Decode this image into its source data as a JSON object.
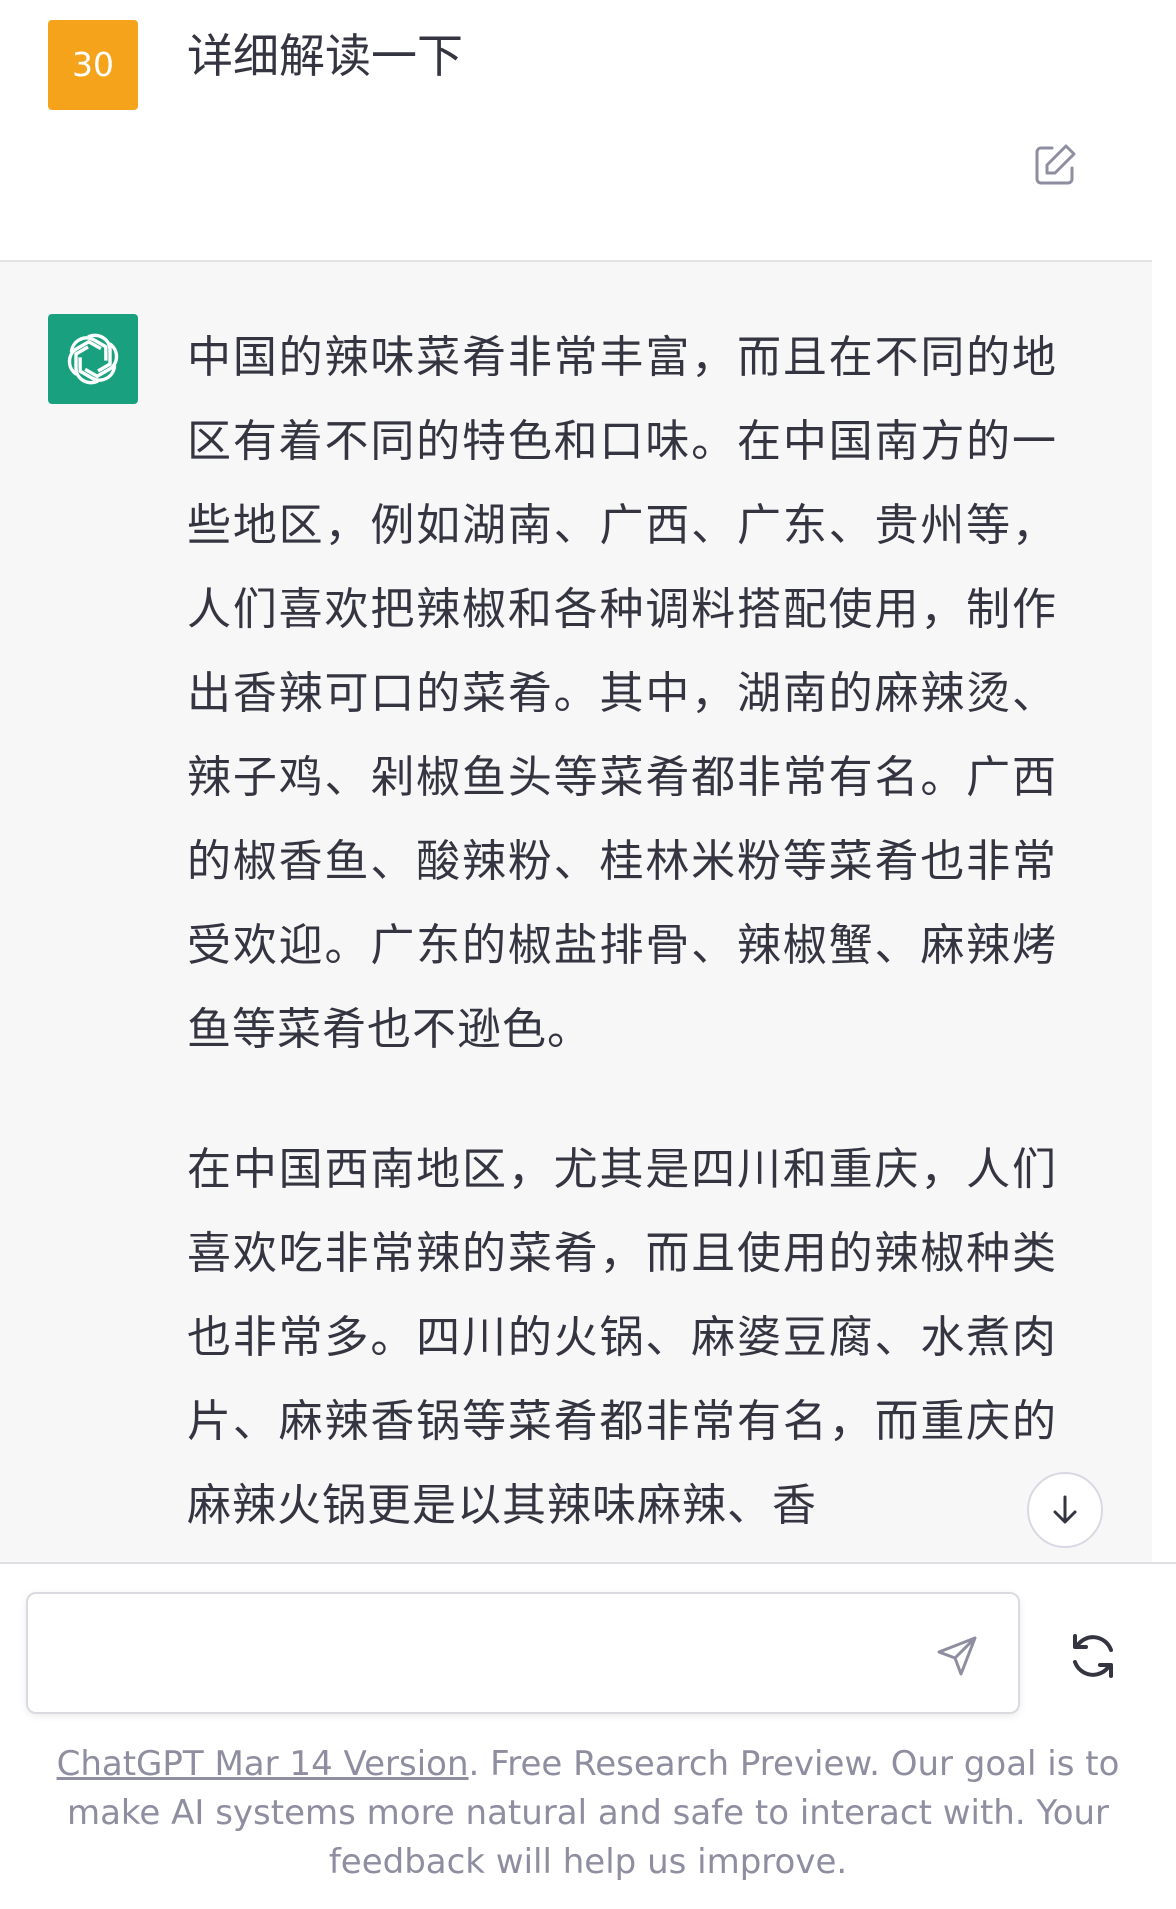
{
  "user_message": {
    "avatar_text": "30",
    "text": "详细解读一下",
    "edit_icon": "edit-icon"
  },
  "assistant_message": {
    "avatar_icon": "openai-logo-icon",
    "paragraphs": [
      "中国的辣味菜肴非常丰富，而且在不同的地区有着不同的特色和口味。在中国南方的一些地区，例如湖南、广西、广东、贵州等，人们喜欢把辣椒和各种调料搭配使用，制作出香辣可口的菜肴。其中，湖南的麻辣烫、辣子鸡、剁椒鱼头等菜肴都非常有名。广西的椒香鱼、酸辣粉、桂林米粉等菜肴也非常受欢迎。广东的椒盐排骨、辣椒蟹、麻辣烤鱼等菜肴也不逊色。",
      "在中国西南地区，尤其是四川和重庆，人们喜欢吃非常辣的菜肴，而且使用的辣椒种类也非常多。四川的火锅、麻婆豆腐、水煮肉片、麻辣香锅等菜肴都非常有名，而重庆的麻辣火锅更是以其辣味麻辣、香"
    ],
    "scroll_icon": "arrow-down-icon"
  },
  "composer": {
    "placeholder": "",
    "send_icon": "send-icon",
    "regenerate_icon": "regenerate-icon"
  },
  "footer": {
    "link_text": "ChatGPT Mar 14 Version",
    "text": ". Free Research Preview. Our goal is to make AI systems more natural and safe to interact with. Your feedback will help us improve."
  },
  "colors": {
    "user_avatar": "#f5a31b",
    "bot_avatar": "#19a17f",
    "assistant_bg": "#f7f7f8",
    "text": "#343541",
    "muted": "#8e8ea0"
  }
}
